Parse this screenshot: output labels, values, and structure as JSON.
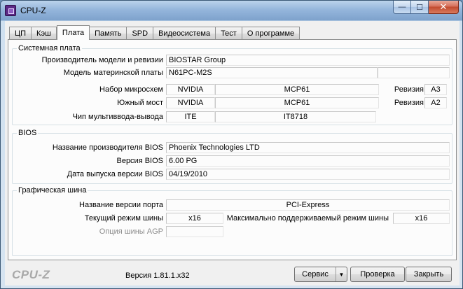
{
  "window": {
    "title": "CPU-Z",
    "min_glyph": "—",
    "max_glyph": "☐",
    "close_glyph": "✕"
  },
  "tabs": [
    {
      "label": "ЦП",
      "active": false
    },
    {
      "label": "Кэш",
      "active": false
    },
    {
      "label": "Плата",
      "active": true
    },
    {
      "label": "Память",
      "active": false
    },
    {
      "label": "SPD",
      "active": false
    },
    {
      "label": "Видеосистема",
      "active": false
    },
    {
      "label": "Тест",
      "active": false
    },
    {
      "label": "О программе",
      "active": false
    }
  ],
  "motherboard": {
    "group_title": "Системная плата",
    "manufacturer_label": "Производитель модели и ревизии",
    "manufacturer": "BIOSTAR Group",
    "model_label": "Модель материнской платы",
    "model": "N61PC-M2S",
    "model_extra": "",
    "chipset_label": "Набор микросхем",
    "chipset_vendor": "NVIDIA",
    "chipset_model": "MCP61",
    "chipset_rev_label": "Ревизия",
    "chipset_rev": "A3",
    "southbridge_label": "Южный мост",
    "southbridge_vendor": "NVIDIA",
    "southbridge_model": "MCP61",
    "southbridge_rev_label": "Ревизия",
    "southbridge_rev": "A2",
    "lpcio_label": "Чип мультиввода-вывода",
    "lpcio_vendor": "ITE",
    "lpcio_model": "IT8718"
  },
  "bios": {
    "group_title": "BIOS",
    "brand_label": "Название производителя BIOS",
    "brand": "Phoenix Technologies LTD",
    "version_label": "Версия BIOS",
    "version": "6.00 PG",
    "date_label": "Дата выпуска версии BIOS",
    "date": "04/19/2010"
  },
  "graphic": {
    "group_title": "Графическая шина",
    "version_label": "Название версии порта",
    "version": "PCI-Express",
    "link_width_label": "Текущий режим шины",
    "link_width": "x16",
    "max_supported_label": "Максимально поддерживаемый режим шины",
    "max_supported": "x16",
    "sideband_label": "Опция шины AGP",
    "sideband": ""
  },
  "footer": {
    "logo": "CPU-Z",
    "version": "Версия 1.81.1.x32",
    "tools_label": "Сервис",
    "tools_arrow": "▼",
    "validate_label": "Проверка",
    "close_label": "Закрыть"
  }
}
